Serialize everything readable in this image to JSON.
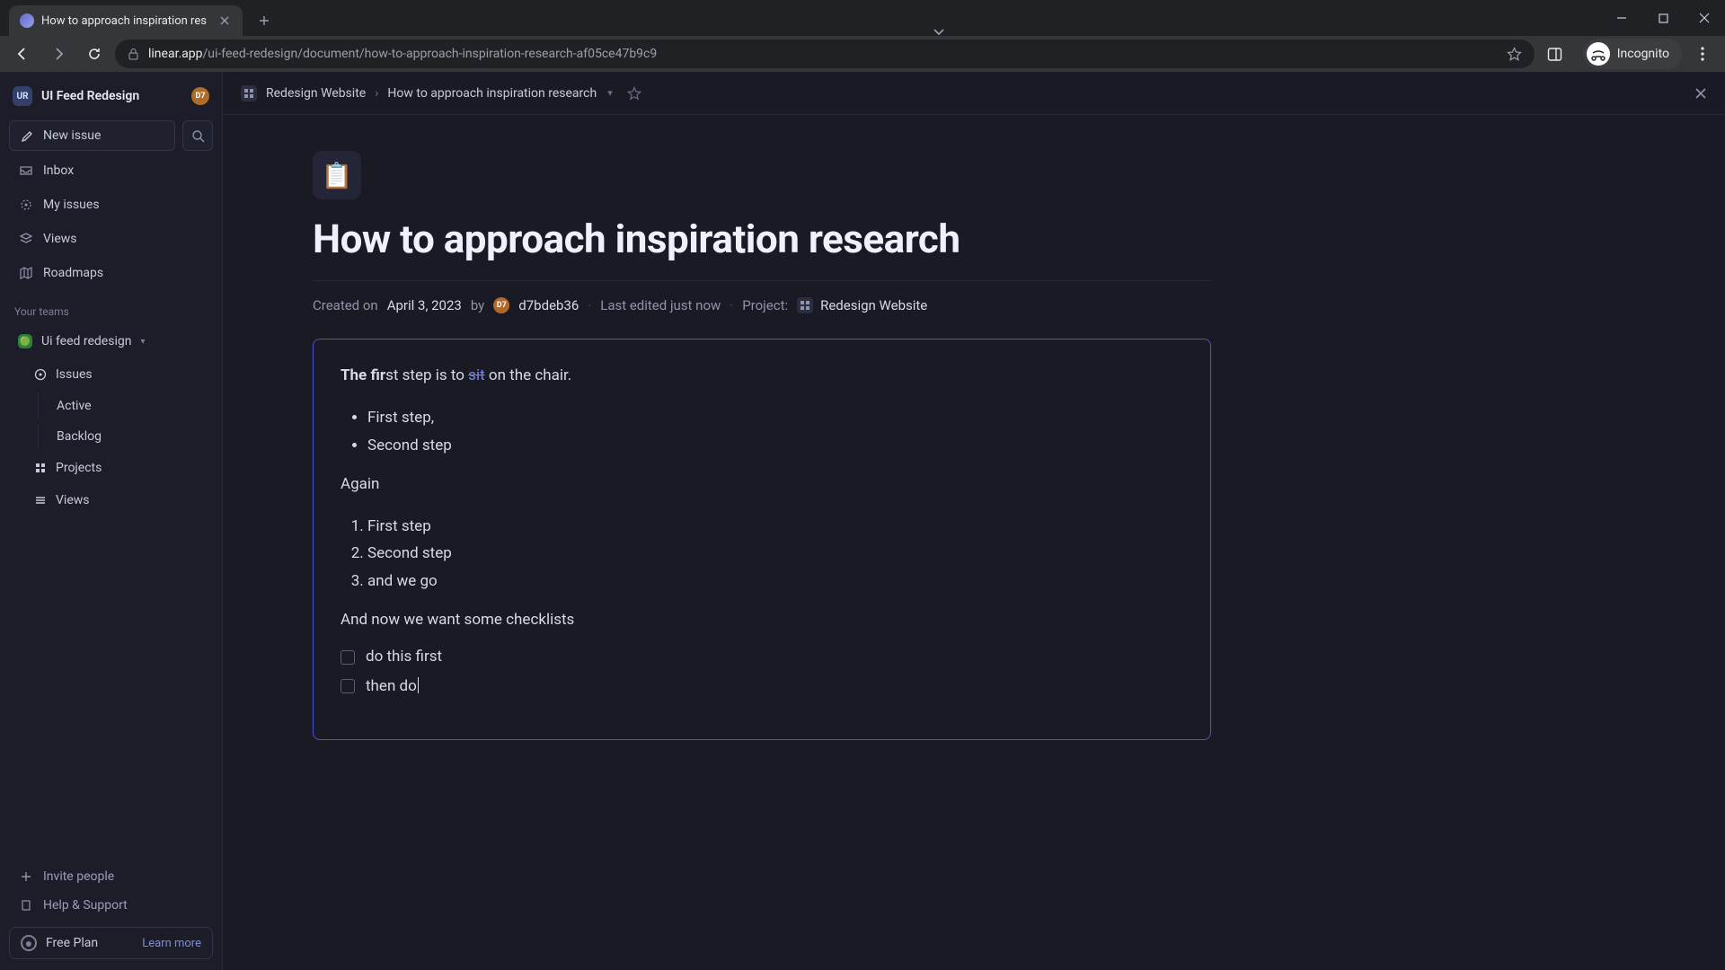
{
  "browser": {
    "tab_title": "How to approach inspiration res",
    "incognito_label": "Incognito",
    "url_host": "linear.app",
    "url_path": "/ui-feed-redesign/document/how-to-approach-inspiration-research-af05ce47b9c9"
  },
  "workspace": {
    "badge": "UR",
    "name": "UI Feed Redesign",
    "user_badge": "D7"
  },
  "sidebar": {
    "new_issue": "New issue",
    "nav": {
      "inbox": "Inbox",
      "my_issues": "My issues",
      "views": "Views",
      "roadmaps": "Roadmaps"
    },
    "teams_label": "Your teams",
    "team": {
      "name": "Ui feed redesign",
      "issues": "Issues",
      "active": "Active",
      "backlog": "Backlog",
      "projects": "Projects",
      "views": "Views"
    },
    "footer": {
      "invite": "Invite people",
      "help": "Help & Support",
      "plan": "Free Plan",
      "learn_more": "Learn more"
    }
  },
  "header": {
    "project": "Redesign Website",
    "sep": "›",
    "doc": "How to approach inspiration research"
  },
  "doc": {
    "icon": "📋",
    "title": "How to approach inspiration research",
    "created_prefix": "Created on",
    "created_date": "April 3, 2023",
    "by": "by",
    "author_badge": "D7",
    "author": "d7bdeb36",
    "last_edited": "Last edited just now",
    "project_label": "Project:",
    "project_name": "Redesign Website"
  },
  "body": {
    "line1_bold": "The fir",
    "line1_mid": "st step is to ",
    "line1_link": "sit",
    "line1_rest": " on the chair.",
    "ul": [
      "First step,",
      "Second step"
    ],
    "again": "Again",
    "ol": [
      "First step",
      "Second step",
      "and we go"
    ],
    "check_intro": "And now we want some checklists",
    "checks": [
      "do this first",
      "then do"
    ]
  }
}
